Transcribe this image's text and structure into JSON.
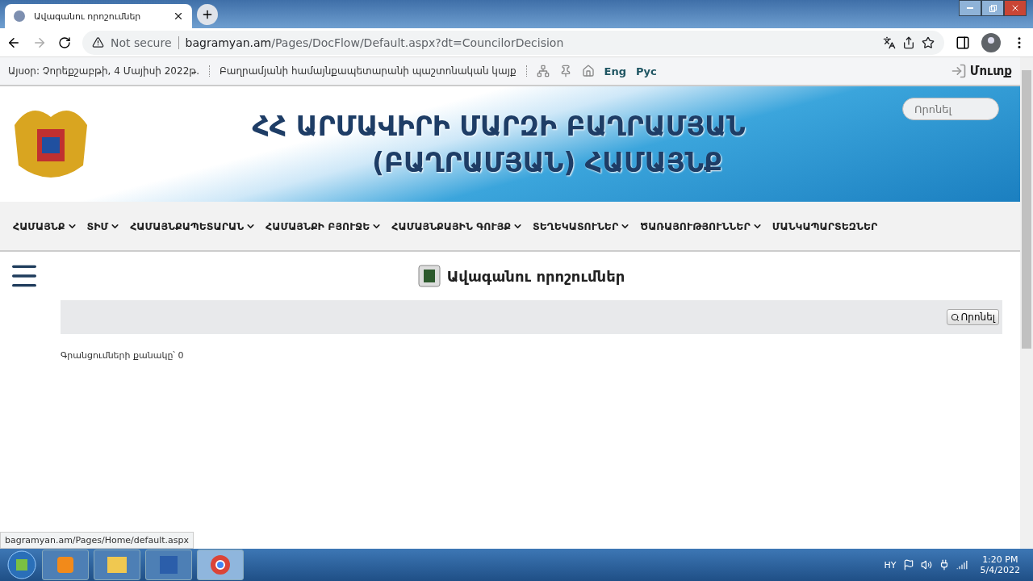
{
  "browser": {
    "tab_title": "Ավագանու որոշումներ",
    "security": "Not secure",
    "url_domain": "bagramyan.am",
    "url_path": "/Pages/DocFlow/Default.aspx?dt=CouncilorDecision"
  },
  "topbar": {
    "date": "Այսօր: Չորեքշաբթի, 4 Մայիսի 2022թ.",
    "site": "Բաղրամյանի համայնքապետարանի պաշտոնական կայք",
    "languages": [
      "Eng",
      "Рус"
    ],
    "login": "Մուտք"
  },
  "header": {
    "title_line_1": "ՀՀ ԱՐՄԱՎԻՐԻ ՄԱՐԶԻ ԲԱՂՐԱՄՅԱՆ",
    "title_line_2": "(ԲԱՂՐԱՄՅԱՆ) ՀԱՄԱՅՆՔ",
    "search": {
      "placeholder": "Որոնել"
    }
  },
  "nav": [
    {
      "label": "ՀԱՄԱՅՆՔ",
      "dropdown": true
    },
    {
      "label": "ՏԻՄ",
      "dropdown": true
    },
    {
      "label": "ՀԱՄԱՅՆՔԱՊԵՏԱՐԱՆ",
      "dropdown": true
    },
    {
      "label": "ՀԱՄԱՅՆՔԻ ԲՅՈՒՋԵ",
      "dropdown": true
    },
    {
      "label": "ՀԱՄԱՅՆՔԱՅԻՆ ԳՈՒՅՔ",
      "dropdown": true
    },
    {
      "label": "ՏԵՂԵԿԱՏՈՒՆԵՐ",
      "dropdown": true
    },
    {
      "label": "ԾԱՌԱՅՈՒԹՅՈՒՆՆԵՐ",
      "dropdown": true
    },
    {
      "label": "ՄԱՆԿԱՊԱՐՏԵԶՆԵՐ",
      "dropdown": false
    }
  ],
  "page": {
    "heading": "Ավագանու որոշումներ",
    "search_button": "Որոնել",
    "count": "Գրանցումների քանակը՝ 0"
  },
  "status_url": "bagramyan.am/Pages/Home/default.aspx",
  "taskbar": {
    "language": "HY",
    "time": "1:20 PM",
    "date": "5/4/2022"
  }
}
